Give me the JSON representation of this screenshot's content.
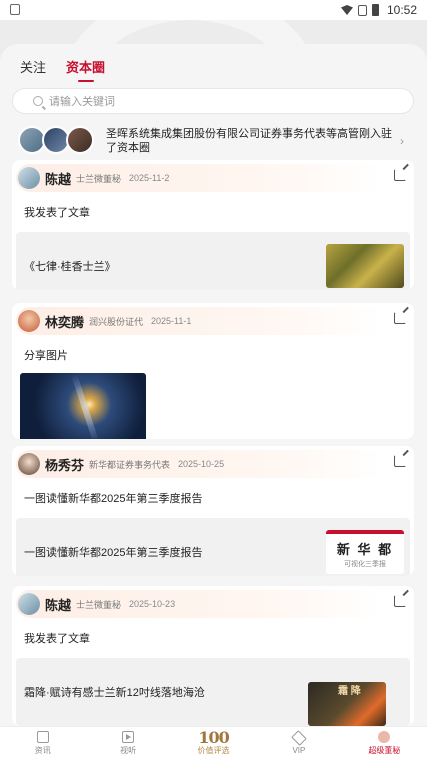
{
  "status_bar": {
    "time": "10:52"
  },
  "tabs": [
    {
      "label": "关注",
      "active": false
    },
    {
      "label": "资本圈",
      "active": true
    }
  ],
  "search": {
    "placeholder": "请输入关键词"
  },
  "notice": {
    "text": "圣晖系统集成集团股份有限公司证券事务代表等高管刚入驻了资本圈"
  },
  "posts": [
    {
      "author": "陈越",
      "role": "士兰微董秘",
      "date": "2025-11-2",
      "action": "我发表了文章",
      "article_title": "《七律·桂香士兰》"
    },
    {
      "author": "林奕腾",
      "role": "润兴股份证代",
      "date": "2025-11-1",
      "action": "分享图片"
    },
    {
      "author": "杨秀芬",
      "role": "新华都证券事务代表",
      "date": "2025-10-25",
      "action": "一图读懂新华都2025年第三季度报告",
      "article_title": "一图读懂新华都2025年第三季度报告",
      "thumb_title": "新 华 都",
      "thumb_subtitle": "可视化三季报"
    },
    {
      "author": "陈越",
      "role": "士兰微董秘",
      "date": "2025-10-23",
      "action": "我发表了文章",
      "article_title": "霜降·赋诗有感士兰新12吋线落地海沧",
      "thumb_text": "霜 降"
    }
  ],
  "bottom_nav": [
    {
      "label": "资讯",
      "icon": "news-icon"
    },
    {
      "label": "视听",
      "icon": "video-icon"
    },
    {
      "label": "价值评选",
      "icon": "value-selection-logo",
      "logo_text": "100"
    },
    {
      "label": "VIP",
      "icon": "vip-icon"
    },
    {
      "label": "超级董秘",
      "icon": "super-secretary-icon",
      "active": true
    }
  ],
  "colors": {
    "accent": "#c8102e",
    "gold": "#a1763a"
  }
}
